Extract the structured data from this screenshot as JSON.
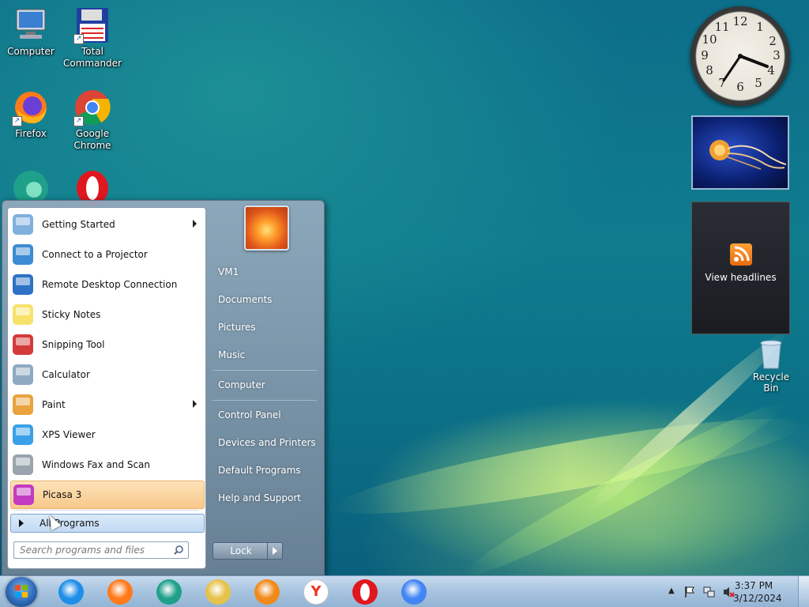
{
  "desktop": {
    "icons": [
      {
        "label": "Computer",
        "icon": "computer-icon"
      },
      {
        "label": "Total\nCommander",
        "icon": "floppy-icon"
      },
      {
        "label": "Firefox",
        "icon": "firefox-icon"
      },
      {
        "label": "Google\nChrome",
        "icon": "chrome-icon"
      },
      {
        "label": "",
        "icon": "edge-icon"
      },
      {
        "label": "",
        "icon": "opera-icon"
      }
    ],
    "recycle_bin": "Recycle Bin"
  },
  "gadgets": {
    "clock_numbers": [
      "12",
      "1",
      "2",
      "3",
      "4",
      "5",
      "6",
      "7",
      "8",
      "9",
      "10",
      "11"
    ],
    "headlines_label": "View headlines"
  },
  "start_menu": {
    "programs": [
      {
        "label": "Getting Started",
        "icon": "getting-started-icon",
        "submenu": true
      },
      {
        "label": "Connect to a Projector",
        "icon": "projector-icon",
        "submenu": false
      },
      {
        "label": "Remote Desktop Connection",
        "icon": "remote-desktop-icon",
        "submenu": false
      },
      {
        "label": "Sticky Notes",
        "icon": "sticky-notes-icon",
        "submenu": false
      },
      {
        "label": "Snipping Tool",
        "icon": "scissors-icon",
        "submenu": false
      },
      {
        "label": "Calculator",
        "icon": "calculator-icon",
        "submenu": false
      },
      {
        "label": "Paint",
        "icon": "paint-icon",
        "submenu": true
      },
      {
        "label": "XPS Viewer",
        "icon": "xps-icon",
        "submenu": false
      },
      {
        "label": "Windows Fax and Scan",
        "icon": "fax-icon",
        "submenu": false
      },
      {
        "label": "Picasa 3",
        "icon": "picasa-icon",
        "submenu": false
      }
    ],
    "all_programs": "All Programs",
    "search_placeholder": "Search programs and files",
    "right_items": [
      "VM1",
      "Documents",
      "Pictures",
      "Music",
      "Computer",
      "Control Panel",
      "Devices and Printers",
      "Default Programs",
      "Help and Support"
    ],
    "lock_label": "Lock"
  },
  "taskbar": {
    "pinned": [
      "ie-icon",
      "firefox-icon",
      "edge-icon",
      "explorer-icon",
      "media-player-icon",
      "yandex-icon",
      "opera-icon",
      "chrome-icon"
    ],
    "time": "3:37 PM",
    "date": "3/12/2024"
  }
}
